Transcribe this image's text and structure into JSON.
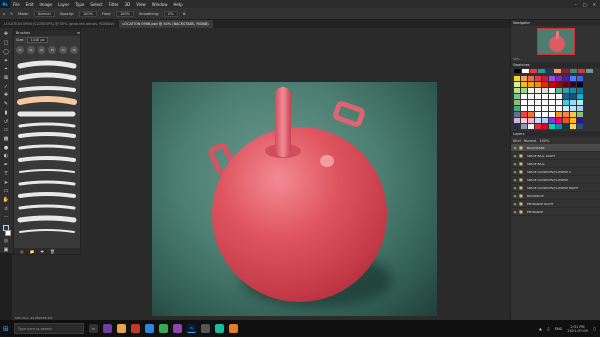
{
  "menubar": {
    "logo": "Ps",
    "items": [
      "File",
      "Edit",
      "Image",
      "Layer",
      "Type",
      "Select",
      "Filter",
      "3D",
      "View",
      "Window",
      "Help"
    ]
  },
  "options": {
    "mode_label": "Mode:",
    "mode_value": "Normal",
    "opacity_label": "Opacity:",
    "opacity_value": "100%",
    "flow_label": "Flow:",
    "flow_value": "100%",
    "smoothing_label": "Smoothing:",
    "smoothing_value": "0%"
  },
  "document": {
    "tabs": [
      {
        "label": "LOCATION 0906 (CLOSEUPS) @ 50% (grab red ontras, RGB/8#)",
        "active": false
      },
      {
        "label": "LOCATION 0906.psd @ 50% (BACKSTABS, RGB/8)",
        "active": true
      }
    ],
    "status": "50%     Doc: 24.0M/358.2M"
  },
  "brushes_panel": {
    "title": "Brushes",
    "size_label": "Size:",
    "size_value": "1440 px",
    "presets": [
      "30",
      "30",
      "30",
      "25",
      "25",
      "36"
    ]
  },
  "navigator": {
    "title": "Navigator",
    "zoom": "50%"
  },
  "swatches": {
    "title": "Swatches",
    "recent": [
      "#000000",
      "#ffffff",
      "#e63946",
      "#2a9d8f",
      "#1b3a6b",
      "#f4a261",
      "#8e2234",
      "#4d7f72",
      "#c53a48",
      "#6c9a8e"
    ],
    "grid": [
      "#f9d423",
      "#f4a261",
      "#e76f51",
      "#e63946",
      "#c9184a",
      "#9d4edd",
      "#7b2cbf",
      "#5a189a",
      "#3a86ff",
      "#4361ee",
      "#d9ed92",
      "#ffba08",
      "#faa307",
      "#f48c06",
      "#dc2f02",
      "#d00000",
      "#9d0208",
      "#6a040f",
      "#370617",
      "#03071e",
      "#b5e48c",
      "#99d98c",
      "#ffffff",
      "#eeeeee",
      "#dddddd",
      "#ffffff",
      "#52b69a",
      "#34a0a4",
      "#168aad",
      "#1a759f",
      "#76c893",
      "#ffffff",
      "#ffffff",
      "#ffffff",
      "#ffffff",
      "#ffffff",
      "#ffffff",
      "#1e6091",
      "#184e77",
      "#00b4d8",
      "#90be6d",
      "#ffffff",
      "#ffffff",
      "#ffffff",
      "#ffffff",
      "#ffffff",
      "#ffffff",
      "#48cae4",
      "#90e0ef",
      "#ade8f4",
      "#43aa8b",
      "#ffffff",
      "#ffffff",
      "#ffffff",
      "#ffffff",
      "#ffffff",
      "#ffffff",
      "#caf0f8",
      "#bde0fe",
      "#a2d2ff",
      "#577590",
      "#f94144",
      "#f3722c",
      "#ffffff",
      "#ffffff",
      "#ffffff",
      "#f8961e",
      "#f9844a",
      "#f9c74f",
      "#90be6d",
      "#cdb4db",
      "#ffc8dd",
      "#ffafcc",
      "#bde0fe",
      "#a2d2ff",
      "#8338ec",
      "#ff006e",
      "#fb5607",
      "#ffbe0b",
      "#3a0ca3",
      "#2b2d42",
      "#8d99ae",
      "#edf2f4",
      "#ef233c",
      "#d90429",
      "#06d6a0",
      "#118ab2",
      "#073b4c",
      "#ffd166",
      "#26547c"
    ]
  },
  "layers": {
    "title": "Layers",
    "kind_label": "Kind",
    "mode": "Normal",
    "opacity": "100%",
    "items": [
      {
        "name": "BACKSTABS",
        "selected": true
      },
      {
        "name": "SPACE BALL RIGHT",
        "selected": false
      },
      {
        "name": "SPACE BALL",
        "selected": false
      },
      {
        "name": "SPACE CLOSEUPS/CLOSEUP 2",
        "selected": false
      },
      {
        "name": "SPACE CLOSEUPS/CLOSEUP",
        "selected": false
      },
      {
        "name": "SPACE CLOSEUPS/CLOSEUP RIGHT",
        "selected": false
      },
      {
        "name": "BACKDROP",
        "selected": false
      },
      {
        "name": "ENTRANCE RIGHT",
        "selected": false
      },
      {
        "name": "ENTRANCE",
        "selected": false
      }
    ]
  },
  "taskbar": {
    "search_placeholder": "Type here to search",
    "time": "2:51 PM",
    "date": "2021-07-09",
    "lang": "ENG"
  }
}
